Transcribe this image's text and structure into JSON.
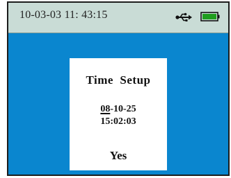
{
  "status_bar": {
    "datetime": "10-03-03 11: 43:15",
    "usb_icon": "usb-icon",
    "battery_icon": "battery-icon",
    "battery_color": "#1e9e1e"
  },
  "dialog": {
    "title": "Time  Setup",
    "date_year": "08",
    "date_rest": "-10-25",
    "time": "15:02:03",
    "confirm_label": "Yes"
  },
  "colors": {
    "screen_background": "#0a86cf",
    "status_bar_background": "#c9dcd6",
    "dialog_background": "#ffffff"
  }
}
